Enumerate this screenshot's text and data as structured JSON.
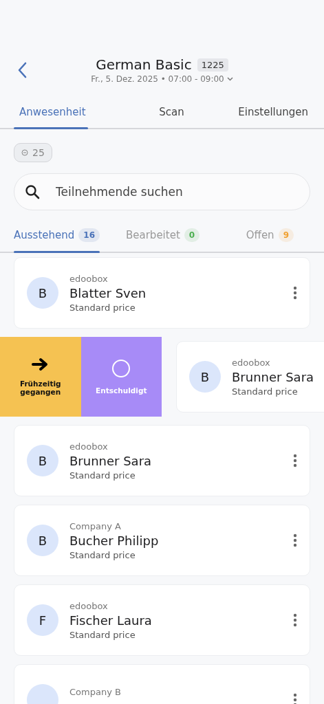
{
  "header": {
    "title": "German Basic",
    "badge": "1225",
    "subtitle": "Fr., 5. Dez. 2025 • 07:00 - 09:00"
  },
  "tabs": [
    {
      "label": "Anwesenheit",
      "selected": true
    },
    {
      "label": "Scan",
      "selected": false
    },
    {
      "label": "Einstellungen",
      "selected": false
    }
  ],
  "total_chip": "25",
  "search": {
    "placeholder": "Teilnehmende suchen"
  },
  "filter_tabs": [
    {
      "label": "Ausstehend",
      "count": "16",
      "selected": true,
      "color": "#4a72b8"
    },
    {
      "label": "Bearbeitet",
      "count": "0",
      "selected": false,
      "color": "#4caf50"
    },
    {
      "label": "Offen",
      "count": "9",
      "selected": false,
      "color": "#f0a030"
    }
  ],
  "participants": [
    {
      "company": "edoobox",
      "initial": "B",
      "name": "Blatter Sven",
      "price": "Standard price",
      "swiped": false
    },
    {
      "company": "edoobox",
      "initial": "B",
      "name": "Brunner Sara",
      "price": "Standard price",
      "swiped": true,
      "actions": [
        {
          "kind": "early",
          "label": "Frühzeitig gegangen"
        },
        {
          "kind": "excused",
          "label": "Entschuldigt"
        }
      ]
    },
    {
      "company": "edoobox",
      "initial": "B",
      "name": "Brunner Sara",
      "price": "Standard price",
      "swiped": false
    },
    {
      "company": "Company A",
      "initial": "B",
      "name": "Bucher Philipp",
      "price": "Standard price",
      "swiped": false
    },
    {
      "company": "edoobox",
      "initial": "F",
      "name": "Fischer Laura",
      "price": "Standard price",
      "swiped": false
    },
    {
      "company": "Company B",
      "swiped": false
    }
  ]
}
